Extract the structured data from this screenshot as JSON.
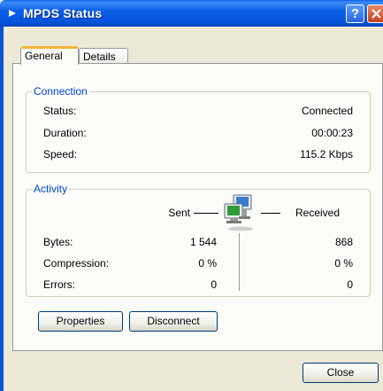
{
  "window": {
    "title": "MPDS Status"
  },
  "tabs": [
    {
      "label": "General"
    },
    {
      "label": "Details"
    }
  ],
  "connection": {
    "group_title": "Connection",
    "rows": [
      {
        "label": "Status:",
        "value": "Connected"
      },
      {
        "label": "Duration:",
        "value": "00:00:23"
      },
      {
        "label": "Speed:",
        "value": "115.2 Kbps"
      }
    ]
  },
  "activity": {
    "group_title": "Activity",
    "sent_label": "Sent",
    "received_label": "Received",
    "rows": [
      {
        "label": "Bytes:",
        "sent": "1 544",
        "received": "868"
      },
      {
        "label": "Compression:",
        "sent": "0 %",
        "received": "0 %"
      },
      {
        "label": "Errors:",
        "sent": "0",
        "received": "0"
      }
    ]
  },
  "buttons": {
    "properties": "Properties",
    "disconnect": "Disconnect",
    "close": "Close"
  },
  "titlebar_buttons": {
    "help": "?"
  },
  "colors": {
    "titlebar": "#0553d9",
    "group_title": "#0046d5",
    "tab_highlight": "#f3b636"
  }
}
